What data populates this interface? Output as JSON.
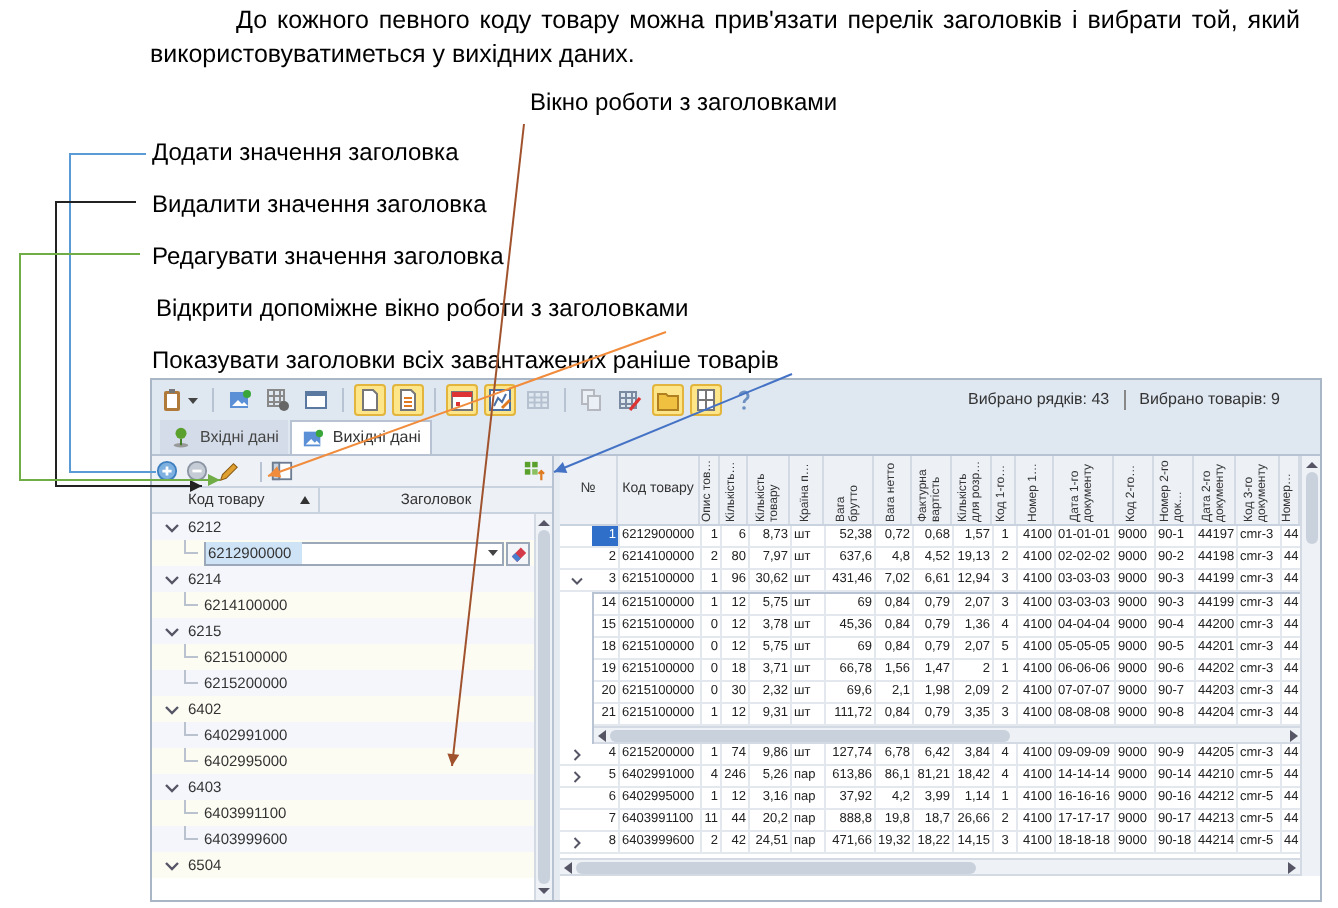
{
  "paragraph": "До кожного певного коду товару можна прив'язати перелік заголовків і вибрати той, який використовуватиметься у вихідних даних.",
  "caption": "Вікно роботи з заголовками",
  "callouts": [
    "Додати значення заголовка",
    "Видалити значення заголовка",
    "Редагувати значення заголовка",
    "Відкрити допоміжне вікно роботи з заголовками",
    "Показувати заголовки всіх завантажених раніше товарів"
  ],
  "app": {
    "toolbar": [
      {
        "kind": "clipboard",
        "on": false,
        "disabled": false
      },
      {
        "kind": "picture",
        "on": false,
        "disabled": false
      },
      {
        "kind": "grid-gear",
        "on": false,
        "disabled": false
      },
      {
        "kind": "window",
        "on": false,
        "disabled": false
      },
      {
        "kind": "page",
        "on": true,
        "disabled": false
      },
      {
        "kind": "page-list",
        "on": true,
        "disabled": false
      },
      {
        "kind": "calendar",
        "on": true,
        "disabled": false
      },
      {
        "kind": "chart",
        "on": true,
        "disabled": false
      },
      {
        "kind": "grid",
        "on": false,
        "disabled": true
      },
      {
        "kind": "copy",
        "on": false,
        "disabled": true
      },
      {
        "kind": "grid-pen",
        "on": false,
        "disabled": false
      },
      {
        "kind": "folder",
        "on": true,
        "disabled": false
      },
      {
        "kind": "columns",
        "on": true,
        "disabled": false
      },
      {
        "kind": "help",
        "on": false,
        "disabled": false
      }
    ],
    "status": [
      "Вибрано рядків: 43",
      "Вибрано товарів: 9"
    ],
    "tabs": [
      {
        "label": "Вхідні дані",
        "kind": "pin",
        "selected": false
      },
      {
        "label": "Вихідні дані",
        "kind": "picture",
        "selected": true
      }
    ],
    "titles_panel": {
      "columns": [
        {
          "label": "Код товару",
          "sorted": true
        },
        {
          "label": "Заголовок",
          "sorted": false
        }
      ],
      "nodes": [
        {
          "label": "6212",
          "expanded": true,
          "children": [
            {
              "label": "6212900000",
              "editing": true
            }
          ]
        },
        {
          "label": "6214",
          "expanded": true,
          "children": [
            {
              "label": "6214100000",
              "editing": false
            }
          ]
        },
        {
          "label": "6215",
          "expanded": true,
          "children": [
            {
              "label": "6215100000",
              "editing": false
            },
            {
              "label": "6215200000",
              "editing": false
            }
          ]
        },
        {
          "label": "6402",
          "expanded": true,
          "children": [
            {
              "label": "6402991000",
              "editing": false
            },
            {
              "label": "6402995000",
              "editing": false
            }
          ]
        },
        {
          "label": "6403",
          "expanded": true,
          "children": [
            {
              "label": "6403991100",
              "editing": false
            },
            {
              "label": "6403999600",
              "editing": false
            }
          ]
        },
        {
          "label": "6504",
          "expanded": true
        }
      ]
    },
    "grid": {
      "columns": [
        "№",
        "Код товару",
        "Опис тов…",
        "Кількість…",
        "Кількість товару",
        "Країна п…",
        "Вага брутто",
        "Вага нетто",
        "Фактурна вартість",
        "Кількість для розр…",
        "Код 1-го…",
        "Номер 1…",
        "Дата 1-го документу",
        "Код 2-го…",
        "Номер 2-го док…",
        "Дата 2-го документу",
        "Код 3-го документу",
        "Номер…"
      ],
      "rows": [
        {
          "expandable": false,
          "selected": true,
          "cells": [
            "1",
            "6212900000",
            "1",
            "6",
            "8,73",
            "шт",
            "52,38",
            "0,72",
            "0,68",
            "1,57",
            "1",
            "4100",
            "01-01-01",
            "9000",
            "90-1",
            "44197",
            "cmr-3",
            "44"
          ]
        },
        {
          "expandable": false,
          "selected": false,
          "cells": [
            "2",
            "6214100000",
            "2",
            "80",
            "7,97",
            "шт",
            "637,6",
            "4,8",
            "4,52",
            "19,13",
            "2",
            "4100",
            "02-02-02",
            "9000",
            "90-2",
            "44198",
            "cmr-3",
            "44"
          ]
        },
        {
          "expandable": true,
          "expanded": true,
          "selected": false,
          "cells": [
            "3",
            "6215100000",
            "1",
            "96",
            "30,62",
            "шт",
            "431,46",
            "7,02",
            "6,61",
            "12,94",
            "3",
            "4100",
            "03-03-03",
            "9000",
            "90-3",
            "44199",
            "cmr-3",
            "44"
          ],
          "children": [
            {
              "selected": false,
              "cells": [
                "14",
                "6215100000",
                "1",
                "12",
                "5,75",
                "шт",
                "69",
                "0,84",
                "0,79",
                "2,07",
                "3",
                "4100",
                "03-03-03",
                "9000",
                "90-3",
                "44199",
                "cmr-3",
                "44"
              ]
            },
            {
              "selected": false,
              "cells": [
                "15",
                "6215100000",
                "0",
                "12",
                "3,78",
                "шт",
                "45,36",
                "0,84",
                "0,79",
                "1,36",
                "4",
                "4100",
                "04-04-04",
                "9000",
                "90-4",
                "44200",
                "cmr-3",
                "44"
              ]
            },
            {
              "selected": false,
              "cells": [
                "18",
                "6215100000",
                "0",
                "12",
                "5,75",
                "шт",
                "69",
                "0,84",
                "0,79",
                "2,07",
                "5",
                "4100",
                "05-05-05",
                "9000",
                "90-5",
                "44201",
                "cmr-3",
                "44"
              ]
            },
            {
              "selected": false,
              "cells": [
                "19",
                "6215100000",
                "0",
                "18",
                "3,71",
                "шт",
                "66,78",
                "1,56",
                "1,47",
                "2",
                "1",
                "4100",
                "06-06-06",
                "9000",
                "90-6",
                "44202",
                "cmr-3",
                "44"
              ]
            },
            {
              "selected": false,
              "cells": [
                "20",
                "6215100000",
                "0",
                "30",
                "2,32",
                "шт",
                "69,6",
                "2,1",
                "1,98",
                "2,09",
                "2",
                "4100",
                "07-07-07",
                "9000",
                "90-7",
                "44203",
                "cmr-3",
                "44"
              ]
            },
            {
              "selected": false,
              "cells": [
                "21",
                "6215100000",
                "1",
                "12",
                "9,31",
                "шт",
                "111,72",
                "0,84",
                "0,79",
                "3,35",
                "3",
                "4100",
                "08-08-08",
                "9000",
                "90-8",
                "44204",
                "cmr-3",
                "44"
              ]
            }
          ]
        },
        {
          "expandable": true,
          "expanded": false,
          "selected": false,
          "cells": [
            "4",
            "6215200000",
            "1",
            "74",
            "9,86",
            "шт",
            "127,74",
            "6,78",
            "6,42",
            "3,84",
            "4",
            "4100",
            "09-09-09",
            "9000",
            "90-9",
            "44205",
            "cmr-3",
            "44"
          ]
        },
        {
          "expandable": true,
          "expanded": false,
          "selected": false,
          "cells": [
            "5",
            "6402991000",
            "4",
            "246",
            "5,26",
            "пар",
            "613,86",
            "86,1",
            "81,21",
            "18,42",
            "4",
            "4100",
            "14-14-14",
            "9000",
            "90-14",
            "44210",
            "cmr-5",
            "44"
          ]
        },
        {
          "expandable": false,
          "selected": false,
          "cells": [
            "6",
            "6402995000",
            "1",
            "12",
            "3,16",
            "пар",
            "37,92",
            "4,2",
            "3,99",
            "1,14",
            "1",
            "4100",
            "16-16-16",
            "9000",
            "90-16",
            "44212",
            "cmr-5",
            "44"
          ]
        },
        {
          "expandable": false,
          "selected": false,
          "cells": [
            "7",
            "6403991100",
            "11",
            "44",
            "20,2",
            "пар",
            "888,8",
            "19,8",
            "18,7",
            "26,66",
            "2",
            "4100",
            "17-17-17",
            "9000",
            "90-17",
            "44213",
            "cmr-5",
            "44"
          ]
        },
        {
          "expandable": true,
          "expanded": false,
          "selected": false,
          "cells": [
            "8",
            "6403999600",
            "2",
            "42",
            "24,51",
            "пар",
            "471,66",
            "19,32",
            "18,22",
            "14,15",
            "3",
            "4100",
            "18-18-18",
            "9000",
            "90-18",
            "44214",
            "cmr-5",
            "44"
          ]
        }
      ]
    }
  }
}
